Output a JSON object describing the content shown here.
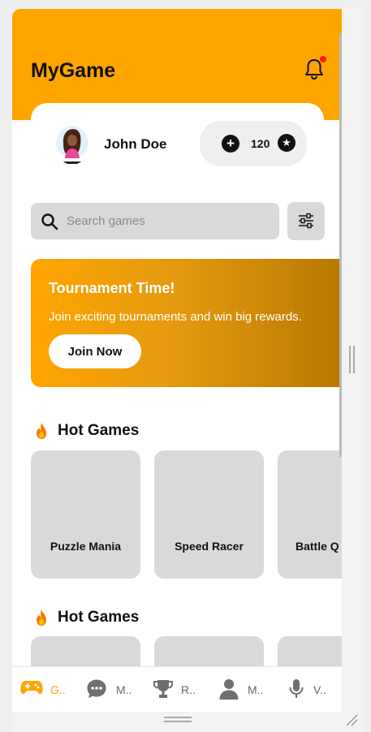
{
  "app": {
    "title": "MyGame"
  },
  "user": {
    "name": "John Doe",
    "coins": "120"
  },
  "search": {
    "placeholder": "Search games",
    "value": ""
  },
  "banner": {
    "title": "Tournament Time!",
    "text": "Join exciting tournaments and win big rewards.",
    "button": "Join Now"
  },
  "sections": [
    {
      "title": "Hot Games",
      "games": [
        "Puzzle Mania",
        "Speed Racer",
        "Battle Q"
      ]
    },
    {
      "title": "Hot Games",
      "games": [
        "",
        "",
        ""
      ]
    }
  ],
  "nav": [
    {
      "label": "G..",
      "icon": "gamepad-icon",
      "active": true
    },
    {
      "label": "M..",
      "icon": "chat-icon",
      "active": false
    },
    {
      "label": "R..",
      "icon": "trophy-icon",
      "active": false
    },
    {
      "label": "M..",
      "icon": "person-icon",
      "active": false
    },
    {
      "label": "V..",
      "icon": "microphone-icon",
      "active": false
    }
  ],
  "colors": {
    "accent": "#FFA500",
    "card": "#d9d9d9",
    "notification": "#ff1a1a"
  }
}
